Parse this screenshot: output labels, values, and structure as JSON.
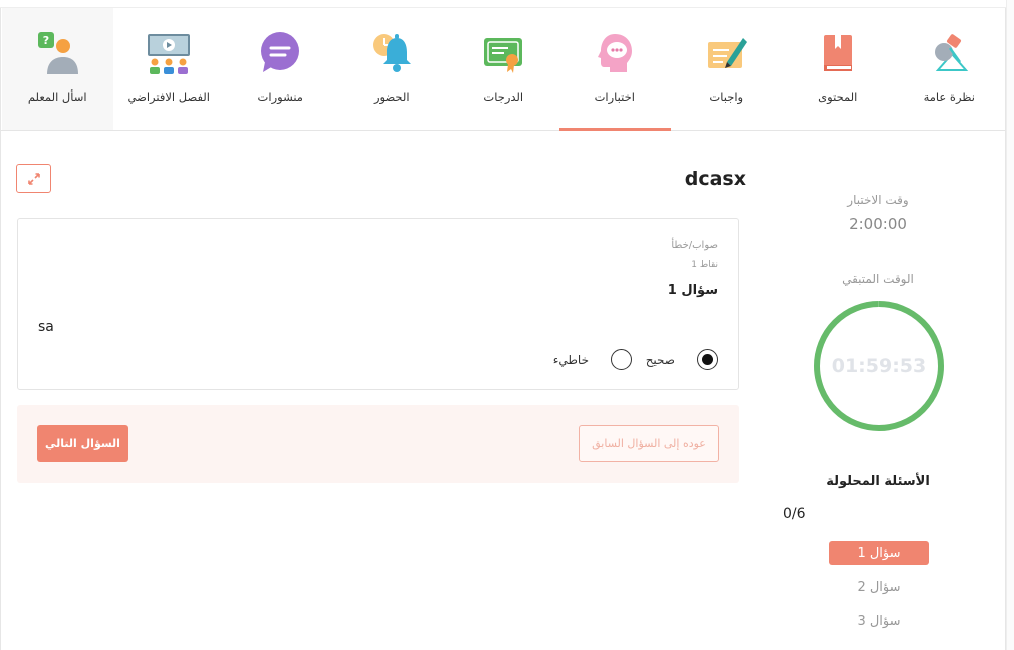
{
  "nav": [
    {
      "key": "overview",
      "label": "نظرة عامة",
      "icon": "lamp-icon",
      "active": false
    },
    {
      "key": "content",
      "label": "المحتوى",
      "icon": "book-icon",
      "active": false
    },
    {
      "key": "homework",
      "label": "واجبات",
      "icon": "pen-paper-icon",
      "active": false
    },
    {
      "key": "tests",
      "label": "اختبارات",
      "icon": "head-chat-icon",
      "active": true
    },
    {
      "key": "grades",
      "label": "الدرجات",
      "icon": "certificate-icon",
      "active": false
    },
    {
      "key": "attendance",
      "label": "الحضور",
      "icon": "bell-clock-icon",
      "active": false
    },
    {
      "key": "posts",
      "label": "منشورات",
      "icon": "chat-bubble-icon",
      "active": false
    },
    {
      "key": "virtual_class",
      "label": "الفصل الافتراضي",
      "icon": "virtual-classroom-icon",
      "active": false
    },
    {
      "key": "ask_teacher",
      "label": "اسأل المعلم",
      "icon": "ask-teacher-icon",
      "active": false
    }
  ],
  "quiz": {
    "title": "dcasx",
    "question": {
      "type": "صواب/خطأ",
      "points": "نقاط 1",
      "title": "سؤال 1",
      "text": "sa",
      "options": [
        {
          "label": "صحيح",
          "selected": true
        },
        {
          "label": "خاطيء",
          "selected": false
        }
      ]
    },
    "next_label": "السؤال التالي",
    "prev_label": "عوده إلى السؤال السابق"
  },
  "sidebar": {
    "test_time_label": "وقت الاختبار",
    "test_time": "2:00:00",
    "remaining_label": "الوقت المتبقي",
    "remaining": "01:59:53",
    "remaining_fraction": 0.999,
    "solved_label": "الأسئلة المحلولة",
    "solved_count": "0/6",
    "questions": [
      {
        "label": "سؤال 1",
        "active": true
      },
      {
        "label": "سؤال 2",
        "active": false
      },
      {
        "label": "سؤال 3",
        "active": false
      }
    ]
  },
  "colors": {
    "accent": "#f08570",
    "timer": "#66bb6a"
  }
}
